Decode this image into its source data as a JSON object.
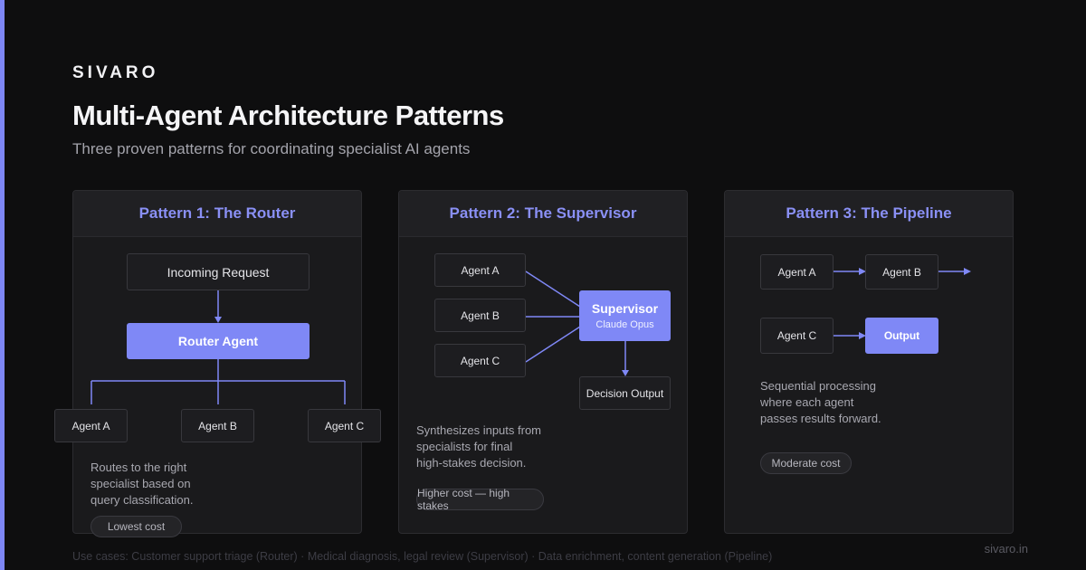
{
  "brand": "SIVARO",
  "title": "Multi-Agent Architecture Patterns",
  "subtitle": "Three proven patterns for coordinating specialist AI agents",
  "accent_color": "#7f88f6",
  "patterns": [
    {
      "title": "Pattern 1: The Router",
      "nodes": {
        "request": "Incoming Request",
        "router": "Router Agent",
        "a": "Agent A",
        "b": "Agent B",
        "c": "Agent C"
      },
      "desc": [
        "Routes to the right",
        "specialist based on",
        "query classification."
      ],
      "cost": "Lowest cost"
    },
    {
      "title": "Pattern 2: The Supervisor",
      "nodes": {
        "a": "Agent A",
        "b": "Agent B",
        "c": "Agent C",
        "supervisor": "Supervisor",
        "supervisor_model": "Claude Opus",
        "output": "Decision Output"
      },
      "desc": [
        "Synthesizes inputs from",
        "specialists for final",
        "high-stakes decision."
      ],
      "cost": "Higher cost — high stakes"
    },
    {
      "title": "Pattern 3: The Pipeline",
      "nodes": {
        "a": "Agent A",
        "b": "Agent B",
        "c": "Agent C",
        "output": "Output"
      },
      "desc": [
        "Sequential processing",
        "where each agent",
        "passes results forward."
      ],
      "cost": "Moderate cost"
    }
  ],
  "footer": "Use cases: Customer support triage (Router) · Medical diagnosis, legal review (Supervisor) · Data enrichment, content generation (Pipeline)",
  "site": "sivaro.in"
}
